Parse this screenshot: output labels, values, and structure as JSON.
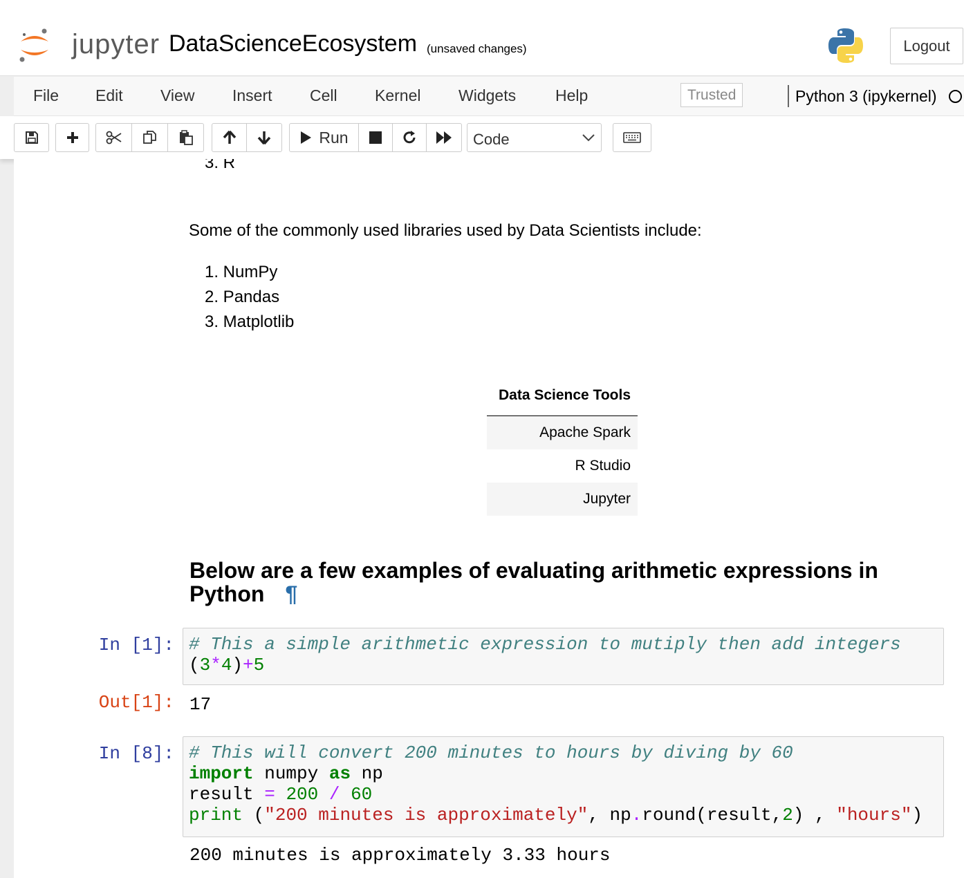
{
  "header": {
    "logo_text": "jupyter",
    "notebook_title": "DataScienceEcosystem",
    "save_status": "(unsaved changes)",
    "logout_label": "Logout"
  },
  "menubar": {
    "items": [
      "File",
      "Edit",
      "View",
      "Insert",
      "Cell",
      "Kernel",
      "Widgets",
      "Help"
    ],
    "trusted_label": "Trusted",
    "kernel_name": "Python 3 (ipykernel)"
  },
  "toolbar": {
    "run_label": "Run",
    "cell_type": "Code"
  },
  "notebook": {
    "partial_list_item": "3. R",
    "libraries_intro": "Some of the commonly used libraries used by Data Scientists include:",
    "libraries": [
      "1. NumPy",
      "2. Pandas",
      "3. Matplotlib"
    ],
    "tools_table": {
      "header": "Data Science Tools",
      "rows": [
        "Apache Spark",
        "R Studio",
        "Jupyter"
      ]
    },
    "heading": "Below are a few examples of evaluating arithmetic expressions in Python",
    "heading_anchor": "¶",
    "cells": [
      {
        "prompt_in": "In [1]:",
        "comment": "# This a simple arithmetic expression to mutiply then add integers",
        "prompt_out": "Out[1]:",
        "output": "17"
      },
      {
        "prompt_in": "In [8]:",
        "comment": "# This will convert 200 minutes to hours by diving by 60",
        "output": "200 minutes is approximately 3.33 hours"
      }
    ]
  },
  "colors": {
    "prompt_in": "#303f9f",
    "prompt_out": "#d84315",
    "code_comment": "#408080",
    "code_string": "#ba2121",
    "code_keyword": "#008000",
    "code_operator": "#aa22ff",
    "logo_orange": "#f37726"
  }
}
